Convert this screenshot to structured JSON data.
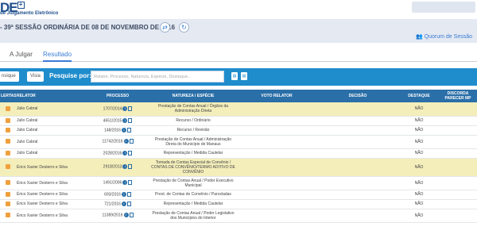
{
  "header": {
    "logo_text": "DE",
    "logo_sub": "de Julgamento Eletrônico",
    "session_title": "- 39ª SESSÃO ORDINÁRIA DE 08 DE NOVEMBRO DE 2016",
    "quorum_label": "Quorum de Sessão"
  },
  "tabs": [
    {
      "label": "A Julgar",
      "active": false
    },
    {
      "label": "Resultado",
      "active": true
    }
  ],
  "search": {
    "btn1": "nsique",
    "btn2": "Visia",
    "label": "Pesquise por:",
    "placeholder": "Relator, Processo, Natureza, Espécie, Destaque..."
  },
  "columns": [
    "LERTAS",
    "RELATOR",
    "PROCESSO",
    "NATUREZA / ESPÉCIE",
    "VOTO RELATOR",
    "DECISÃO",
    "DESTAQUE",
    "DISCORDA PARECER MP"
  ],
  "rows": [
    {
      "relator": "Julio Cabral",
      "processo": "1707/2014",
      "natureza": "Prestação de Contas Anual / Órgãos da Administração Direta",
      "destaque": "NÃO",
      "highlight": true
    },
    {
      "relator": "Julio Cabral",
      "processo": "4651/2015",
      "natureza": "Recurso / Ordinário",
      "destaque": "NÃO",
      "highlight": false
    },
    {
      "relator": "Julio Cabral",
      "processo": "148/2016",
      "natureza": "Recurso / Revisão",
      "destaque": "NÃO",
      "highlight": false
    },
    {
      "relator": "Julio Cabral",
      "processo": "11742/2016",
      "natureza": "Prestação de Contas Anual / Administração Direta do Município de Manaus",
      "destaque": "NÃO",
      "highlight": false
    },
    {
      "relator": "Julio Cabral",
      "processo": "2028/2016",
      "natureza": "Representação / Medida Cautelar",
      "destaque": "NÃO",
      "highlight": false
    },
    {
      "relator": "Érico Xavier Desterro e Silva",
      "processo": "2918/2013",
      "natureza": "Tomada de Contas Especial de Convênio / CONTAS DE CONVÊNIO/TERMO ADITIVO DE CONVÊNIO",
      "destaque": "NÃO",
      "highlight": true
    },
    {
      "relator": "Érico Xavier Desterro e Silva",
      "processo": "1491/2006",
      "natureza": "Prestação de Contas Anual / Poder Executivo Municipal",
      "destaque": "NÃO",
      "highlight": false
    },
    {
      "relator": "Érico Xavier Desterro e Silva",
      "processo": "693/2016",
      "natureza": "Prest. de Contas de Convênio / Parceladas",
      "destaque": "NÃO",
      "highlight": false
    },
    {
      "relator": "Érico Xavier Desterro e Silva",
      "processo": "721/2016",
      "natureza": "Representação / Medida Cautelar",
      "destaque": "NÃO",
      "highlight": false
    },
    {
      "relator": "Érico Xavier Desterro e Silva",
      "processo": "11389/2016",
      "natureza": "Prestação de Contas Anual / Poder Legislativo dos Municípios do Interior",
      "destaque": "NÃO",
      "highlight": false
    }
  ]
}
